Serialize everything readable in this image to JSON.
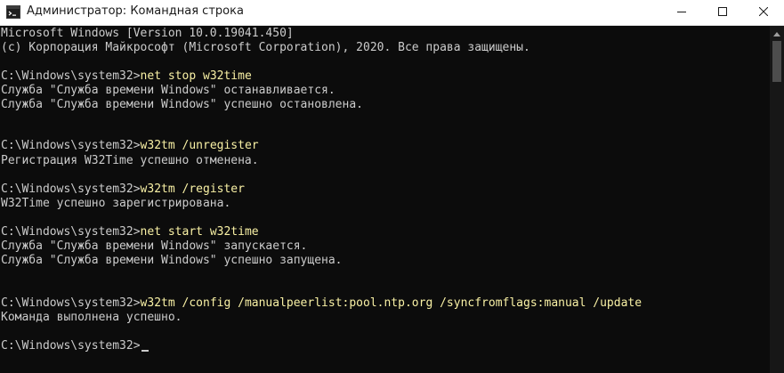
{
  "window": {
    "title": "Администратор: Командная строка",
    "icon": "cmd-app-icon",
    "controls": [
      "minimize-icon",
      "maximize-icon",
      "close-icon"
    ]
  },
  "console": {
    "colors": {
      "background": "#0c0c0c",
      "text": "#cccccc",
      "command": "#f9f1a5"
    },
    "lines": [
      {
        "text": "Microsoft Windows [Version 10.0.19041.450]"
      },
      {
        "text": "(c) Корпорация Майкрософт (Microsoft Corporation), 2020. Все права защищены."
      },
      {
        "prompt": "C:\\Windows\\system32>",
        "command": "net stop w32time"
      },
      {
        "text": "Служба \"Служба времени Windows\" останавливается."
      },
      {
        "text": "Служба \"Служба времени Windows\" успешно остановлена."
      },
      {
        "prompt": "C:\\Windows\\system32>",
        "command": "w32tm /unregister"
      },
      {
        "text": "Регистрация W32Time успешно отменена."
      },
      {
        "prompt": "C:\\Windows\\system32>",
        "command": "w32tm /register"
      },
      {
        "text": "W32Time успешно зарегистрирована."
      },
      {
        "prompt": "C:\\Windows\\system32>",
        "command": "net start w32time"
      },
      {
        "text": "Служба \"Служба времени Windows\" запускается."
      },
      {
        "text": "Служба \"Служба времени Windows\" успешно запущена."
      },
      {
        "prompt": "C:\\Windows\\system32>",
        "command": "w32tm /config /manualpeerlist:pool.ntp.org /syncfromflags:manual /update"
      },
      {
        "text": "Команда выполнена успешно."
      },
      {
        "prompt": "C:\\Windows\\system32>"
      }
    ]
  }
}
